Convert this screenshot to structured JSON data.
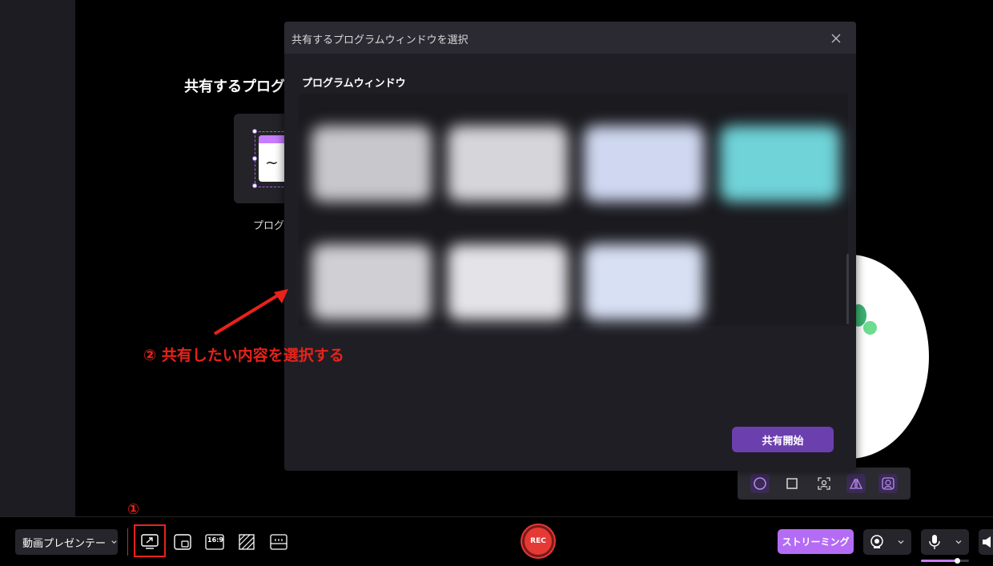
{
  "background": {
    "heading": "共有するプログラ",
    "card_label": "プログラ"
  },
  "dialog": {
    "title": "共有するプログラムウィンドウを選択",
    "section_label": "プログラムウィンドウ",
    "share_button": "共有開始",
    "thumbnail_colors": [
      "#c8c8cc",
      "#d6d6da",
      "#cfd8f0",
      "#6fd3d8",
      "#d0d0d4",
      "#e4e4e8",
      "#d8e0f4"
    ]
  },
  "annotations": {
    "step1": "①",
    "step2": "② 共有したい内容を選択する",
    "color": "#e8221a"
  },
  "toolbar": {
    "mode_label": "動画プレゼンテー",
    "rec_label": "REC",
    "streaming_label": "ストリーミング",
    "aspect_label": "16:9",
    "mic_level": 0.75
  },
  "colors": {
    "accent_purple": "#b46cf5",
    "share_purple": "#6c3fae",
    "rec_red": "#e53935"
  }
}
